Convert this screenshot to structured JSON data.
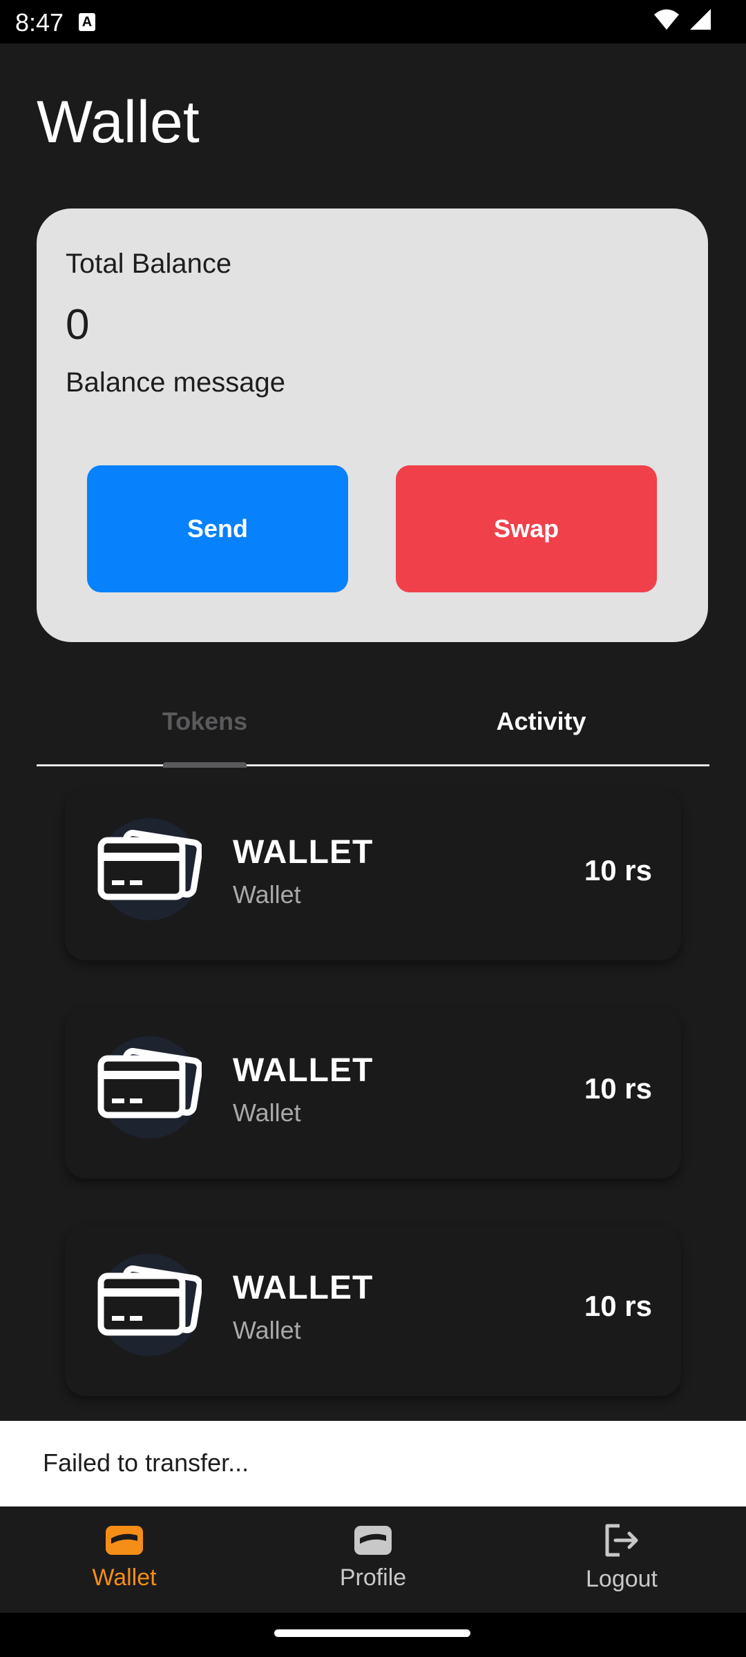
{
  "status_bar": {
    "time": "8:47",
    "badge": "A"
  },
  "header": {
    "title": "Wallet"
  },
  "balance": {
    "label": "Total Balance",
    "value": "0",
    "message": "Balance message",
    "send_label": "Send",
    "swap_label": "Swap"
  },
  "tabs": [
    {
      "label": "Tokens",
      "selected": true
    },
    {
      "label": "Activity",
      "selected": false
    }
  ],
  "tokens": [
    {
      "name": "WALLET",
      "subtitle": "Wallet",
      "amount": "10 rs",
      "icon": "credit-cards-icon"
    },
    {
      "name": "WALLET",
      "subtitle": "Wallet",
      "amount": "10 rs",
      "icon": "credit-cards-icon"
    },
    {
      "name": "WALLET",
      "subtitle": "Wallet",
      "amount": "10 rs",
      "icon": "credit-cards-icon"
    }
  ],
  "snackbar": {
    "message": "Failed to transfer..."
  },
  "bottom_nav": [
    {
      "label": "Wallet",
      "icon": "wallet-icon",
      "active": true
    },
    {
      "label": "Profile",
      "icon": "wallet-icon",
      "active": false
    },
    {
      "label": "Logout",
      "icon": "logout-icon",
      "active": false
    }
  ],
  "colors": {
    "background": "#1b1b1c",
    "card": "#e2e2e2",
    "send": "#0781fc",
    "swap": "#f0414b",
    "accent": "#f58e16"
  }
}
